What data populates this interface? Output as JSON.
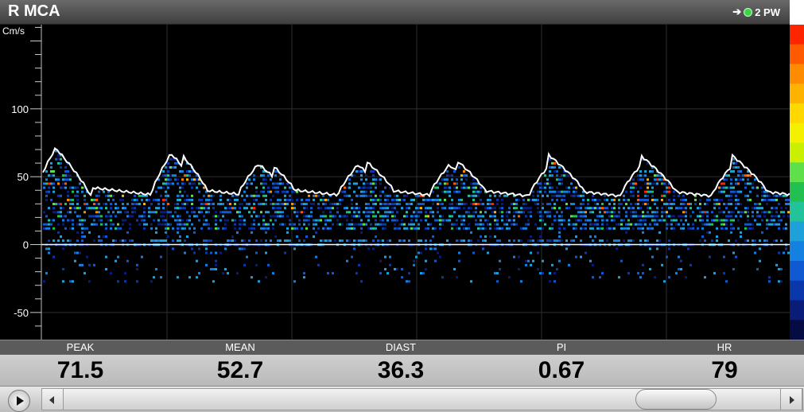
{
  "header": {
    "title": "R MCA",
    "probe_label": "2 PW",
    "arrow_icon": "arrow-right-icon"
  },
  "axis": {
    "unit": "Cm/s",
    "ticks": [
      "100",
      "50",
      "0",
      "-50"
    ],
    "tick_values": [
      100,
      50,
      0,
      -50
    ],
    "range": [
      -70,
      162
    ]
  },
  "colors": {
    "background": "#000000",
    "envelope": "#ffffff",
    "colormap": [
      "#ff2400",
      "#ff5a00",
      "#ff8c00",
      "#ffb300",
      "#ffd800",
      "#f4f000",
      "#c8f000",
      "#5fe04a",
      "#22c050",
      "#23c39a",
      "#1ea0d8",
      "#1480e0",
      "#0f5ad2",
      "#0a37aa",
      "#081c78",
      "#050c44"
    ]
  },
  "metrics": [
    {
      "label": "PEAK",
      "value": "71.5"
    },
    {
      "label": "MEAN",
      "value": "52.7"
    },
    {
      "label": "DIAST",
      "value": "36.3"
    },
    {
      "label": "PI",
      "value": "0.67"
    },
    {
      "label": "HR",
      "value": "79"
    }
  ],
  "playback": {
    "play_icon": "play-icon",
    "scroll_position": 0.9
  }
}
